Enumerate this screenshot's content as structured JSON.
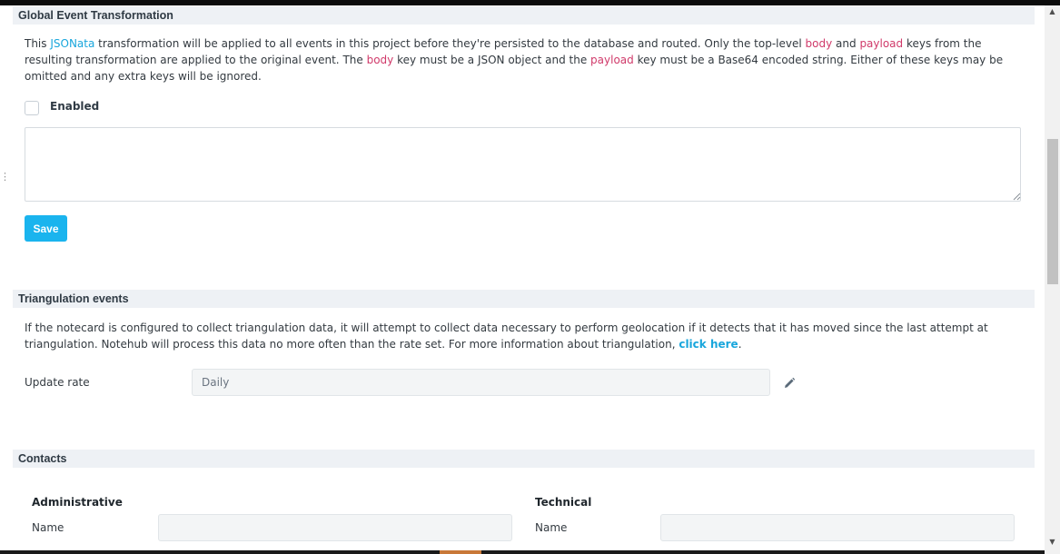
{
  "global_transform": {
    "header": "Global Event Transformation",
    "desc": {
      "t1": "This ",
      "jsonata": "JSONata",
      "t2": " transformation will be applied to all events in this project before they're persisted to the database and routed. Only the top-level ",
      "body1": "body",
      "t3": " and ",
      "payload1": "payload",
      "t4": " keys from the resulting transformation are applied to the original event. The ",
      "body2": "body",
      "t5": " key must be a JSON object and the ",
      "payload2": "payload",
      "t6": " key must be a Base64 encoded string. Either of these keys may be omitted and any extra keys will be ignored."
    },
    "enabled_label": "Enabled",
    "enabled_checked": false,
    "textarea_value": "",
    "save_label": "Save"
  },
  "triangulation": {
    "header": "Triangulation events",
    "desc_text": "If the notecard is configured to collect triangulation data, it will attempt to collect data necessary to perform geolocation if it detects that it has moved since the last attempt at triangulation. Notehub will process this data no more often than the rate set. For more information about triangulation, ",
    "link_text": "click here",
    "desc_end": ".",
    "update_rate_label": "Update rate",
    "update_rate_value": "Daily"
  },
  "contacts": {
    "header": "Contacts",
    "administrative": {
      "title": "Administrative",
      "name_label": "Name",
      "name_value": ""
    },
    "technical": {
      "title": "Technical",
      "name_label": "Name",
      "name_value": ""
    }
  },
  "icons": {
    "edit": "pencil-icon",
    "scroll_up": "triangle-up-icon",
    "scroll_down": "triangle-down-icon"
  },
  "colors": {
    "accent": "#1ab4ee",
    "keyword": "#d03a6a",
    "link": "#18a6dc",
    "section_bg": "#eef1f5"
  }
}
